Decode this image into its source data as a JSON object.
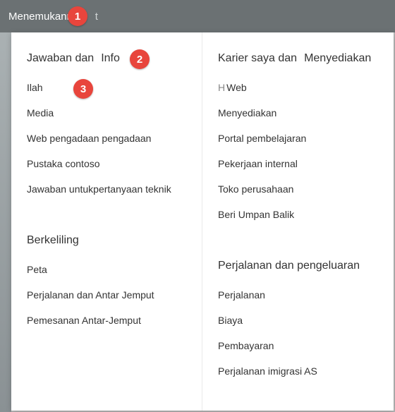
{
  "topbar": {
    "title": "Menemukannya",
    "trailingChar": "t"
  },
  "badges": {
    "b1": "1",
    "b2": "2",
    "b3": "3"
  },
  "columns": {
    "left": {
      "section1": {
        "headerPart1": "Jawaban dan",
        "headerPart2": "Info",
        "links": [
          "Ilah",
          "Media",
          "Web pengadaan pengadaan",
          "Pustaka contoso",
          "Jawaban untukpertanyaan teknik"
        ]
      },
      "section2": {
        "header": "Berkeliling",
        "links": [
          "Peta",
          "Perjalanan dan Antar Jemput",
          "Pemesanan Antar-Jemput"
        ]
      }
    },
    "right": {
      "section1": {
        "headerPart1": "Karier saya dan",
        "headerPart2": "Menyediakan",
        "links": [
          {
            "prefix": "H",
            "text": "Web"
          },
          {
            "prefix": "",
            "text": "Menyediakan"
          },
          {
            "prefix": "",
            "text": "Portal pembelajaran"
          },
          {
            "prefix": "",
            "text": "Pekerjaan internal"
          },
          {
            "prefix": "",
            "text": "Toko perusahaan"
          },
          {
            "prefix": "",
            "text": "Beri Umpan Balik"
          }
        ]
      },
      "section2": {
        "header": "Perjalanan dan pengeluaran",
        "links": [
          "Perjalanan",
          "Biaya",
          "Pembayaran",
          "Perjalanan imigrasi AS"
        ]
      }
    }
  }
}
